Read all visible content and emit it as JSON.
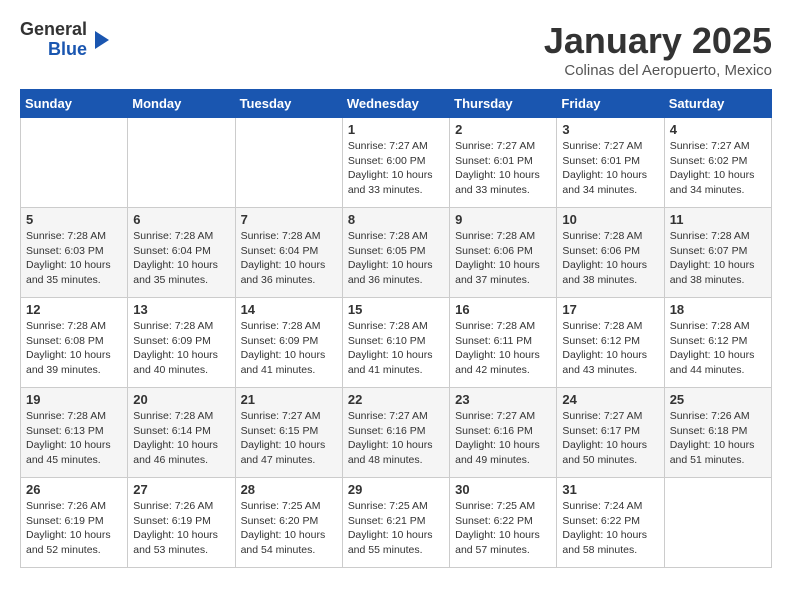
{
  "logo": {
    "line1": "General",
    "line2": "Blue"
  },
  "header": {
    "month": "January 2025",
    "location": "Colinas del Aeropuerto, Mexico"
  },
  "weekdays": [
    "Sunday",
    "Monday",
    "Tuesday",
    "Wednesday",
    "Thursday",
    "Friday",
    "Saturday"
  ],
  "weeks": [
    [
      {
        "day": "",
        "info": ""
      },
      {
        "day": "",
        "info": ""
      },
      {
        "day": "",
        "info": ""
      },
      {
        "day": "1",
        "info": "Sunrise: 7:27 AM\nSunset: 6:00 PM\nDaylight: 10 hours\nand 33 minutes."
      },
      {
        "day": "2",
        "info": "Sunrise: 7:27 AM\nSunset: 6:01 PM\nDaylight: 10 hours\nand 33 minutes."
      },
      {
        "day": "3",
        "info": "Sunrise: 7:27 AM\nSunset: 6:01 PM\nDaylight: 10 hours\nand 34 minutes."
      },
      {
        "day": "4",
        "info": "Sunrise: 7:27 AM\nSunset: 6:02 PM\nDaylight: 10 hours\nand 34 minutes."
      }
    ],
    [
      {
        "day": "5",
        "info": "Sunrise: 7:28 AM\nSunset: 6:03 PM\nDaylight: 10 hours\nand 35 minutes."
      },
      {
        "day": "6",
        "info": "Sunrise: 7:28 AM\nSunset: 6:04 PM\nDaylight: 10 hours\nand 35 minutes."
      },
      {
        "day": "7",
        "info": "Sunrise: 7:28 AM\nSunset: 6:04 PM\nDaylight: 10 hours\nand 36 minutes."
      },
      {
        "day": "8",
        "info": "Sunrise: 7:28 AM\nSunset: 6:05 PM\nDaylight: 10 hours\nand 36 minutes."
      },
      {
        "day": "9",
        "info": "Sunrise: 7:28 AM\nSunset: 6:06 PM\nDaylight: 10 hours\nand 37 minutes."
      },
      {
        "day": "10",
        "info": "Sunrise: 7:28 AM\nSunset: 6:06 PM\nDaylight: 10 hours\nand 38 minutes."
      },
      {
        "day": "11",
        "info": "Sunrise: 7:28 AM\nSunset: 6:07 PM\nDaylight: 10 hours\nand 38 minutes."
      }
    ],
    [
      {
        "day": "12",
        "info": "Sunrise: 7:28 AM\nSunset: 6:08 PM\nDaylight: 10 hours\nand 39 minutes."
      },
      {
        "day": "13",
        "info": "Sunrise: 7:28 AM\nSunset: 6:09 PM\nDaylight: 10 hours\nand 40 minutes."
      },
      {
        "day": "14",
        "info": "Sunrise: 7:28 AM\nSunset: 6:09 PM\nDaylight: 10 hours\nand 41 minutes."
      },
      {
        "day": "15",
        "info": "Sunrise: 7:28 AM\nSunset: 6:10 PM\nDaylight: 10 hours\nand 41 minutes."
      },
      {
        "day": "16",
        "info": "Sunrise: 7:28 AM\nSunset: 6:11 PM\nDaylight: 10 hours\nand 42 minutes."
      },
      {
        "day": "17",
        "info": "Sunrise: 7:28 AM\nSunset: 6:12 PM\nDaylight: 10 hours\nand 43 minutes."
      },
      {
        "day": "18",
        "info": "Sunrise: 7:28 AM\nSunset: 6:12 PM\nDaylight: 10 hours\nand 44 minutes."
      }
    ],
    [
      {
        "day": "19",
        "info": "Sunrise: 7:28 AM\nSunset: 6:13 PM\nDaylight: 10 hours\nand 45 minutes."
      },
      {
        "day": "20",
        "info": "Sunrise: 7:28 AM\nSunset: 6:14 PM\nDaylight: 10 hours\nand 46 minutes."
      },
      {
        "day": "21",
        "info": "Sunrise: 7:27 AM\nSunset: 6:15 PM\nDaylight: 10 hours\nand 47 minutes."
      },
      {
        "day": "22",
        "info": "Sunrise: 7:27 AM\nSunset: 6:16 PM\nDaylight: 10 hours\nand 48 minutes."
      },
      {
        "day": "23",
        "info": "Sunrise: 7:27 AM\nSunset: 6:16 PM\nDaylight: 10 hours\nand 49 minutes."
      },
      {
        "day": "24",
        "info": "Sunrise: 7:27 AM\nSunset: 6:17 PM\nDaylight: 10 hours\nand 50 minutes."
      },
      {
        "day": "25",
        "info": "Sunrise: 7:26 AM\nSunset: 6:18 PM\nDaylight: 10 hours\nand 51 minutes."
      }
    ],
    [
      {
        "day": "26",
        "info": "Sunrise: 7:26 AM\nSunset: 6:19 PM\nDaylight: 10 hours\nand 52 minutes."
      },
      {
        "day": "27",
        "info": "Sunrise: 7:26 AM\nSunset: 6:19 PM\nDaylight: 10 hours\nand 53 minutes."
      },
      {
        "day": "28",
        "info": "Sunrise: 7:25 AM\nSunset: 6:20 PM\nDaylight: 10 hours\nand 54 minutes."
      },
      {
        "day": "29",
        "info": "Sunrise: 7:25 AM\nSunset: 6:21 PM\nDaylight: 10 hours\nand 55 minutes."
      },
      {
        "day": "30",
        "info": "Sunrise: 7:25 AM\nSunset: 6:22 PM\nDaylight: 10 hours\nand 57 minutes."
      },
      {
        "day": "31",
        "info": "Sunrise: 7:24 AM\nSunset: 6:22 PM\nDaylight: 10 hours\nand 58 minutes."
      },
      {
        "day": "",
        "info": ""
      }
    ]
  ]
}
